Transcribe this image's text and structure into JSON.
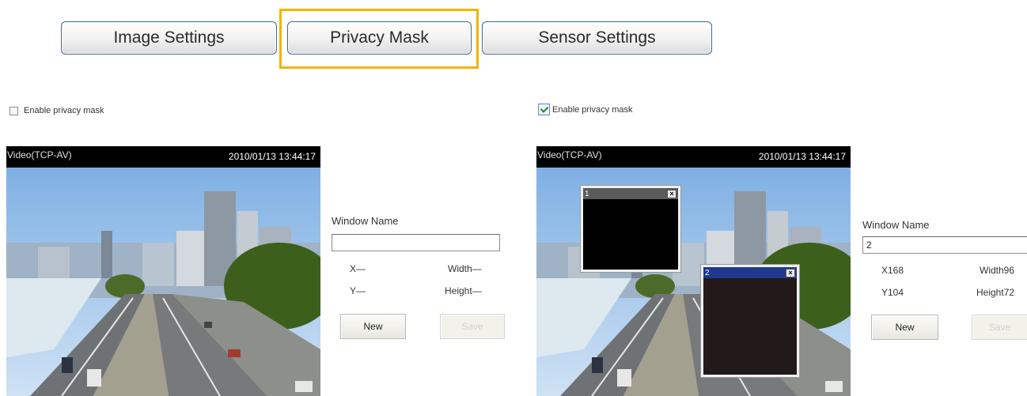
{
  "tabs": [
    {
      "label": "Image Settings"
    },
    {
      "label": "Privacy Mask"
    },
    {
      "label": "Sensor Settings"
    }
  ],
  "left_panel": {
    "enable_label": "Enable privacy mask",
    "enabled": false,
    "video_label": "Video(TCP-AV)",
    "timestamp": "2010/01/13 13:44:17",
    "window_name_label": "Window Name",
    "window_name_value": "",
    "x_text": "X—",
    "y_text": "Y—",
    "width_text": "Width—",
    "height_text": "Height—",
    "new_label": "New",
    "save_label": "Save"
  },
  "right_panel": {
    "enable_label": "Enable privacy mask",
    "enabled": true,
    "video_label": "Video(TCP-AV)",
    "timestamp": "2010/01/13 13:44:17",
    "window_name_label": "Window Name",
    "window_name_value": "2",
    "x_text": "X168",
    "y_text": "Y104",
    "width_text": "Width96",
    "height_text": "Height72",
    "new_label": "New",
    "save_label": "Save",
    "masks": [
      {
        "name": "1",
        "close": "×",
        "active": false
      },
      {
        "name": "2",
        "close": "×",
        "active": true
      }
    ]
  },
  "colors": {
    "highlight": "#f2b400",
    "tab_border": "#3f6790",
    "active_mask_title": "#1f3a8c",
    "inactive_mask_title": "#5a5a5a"
  }
}
